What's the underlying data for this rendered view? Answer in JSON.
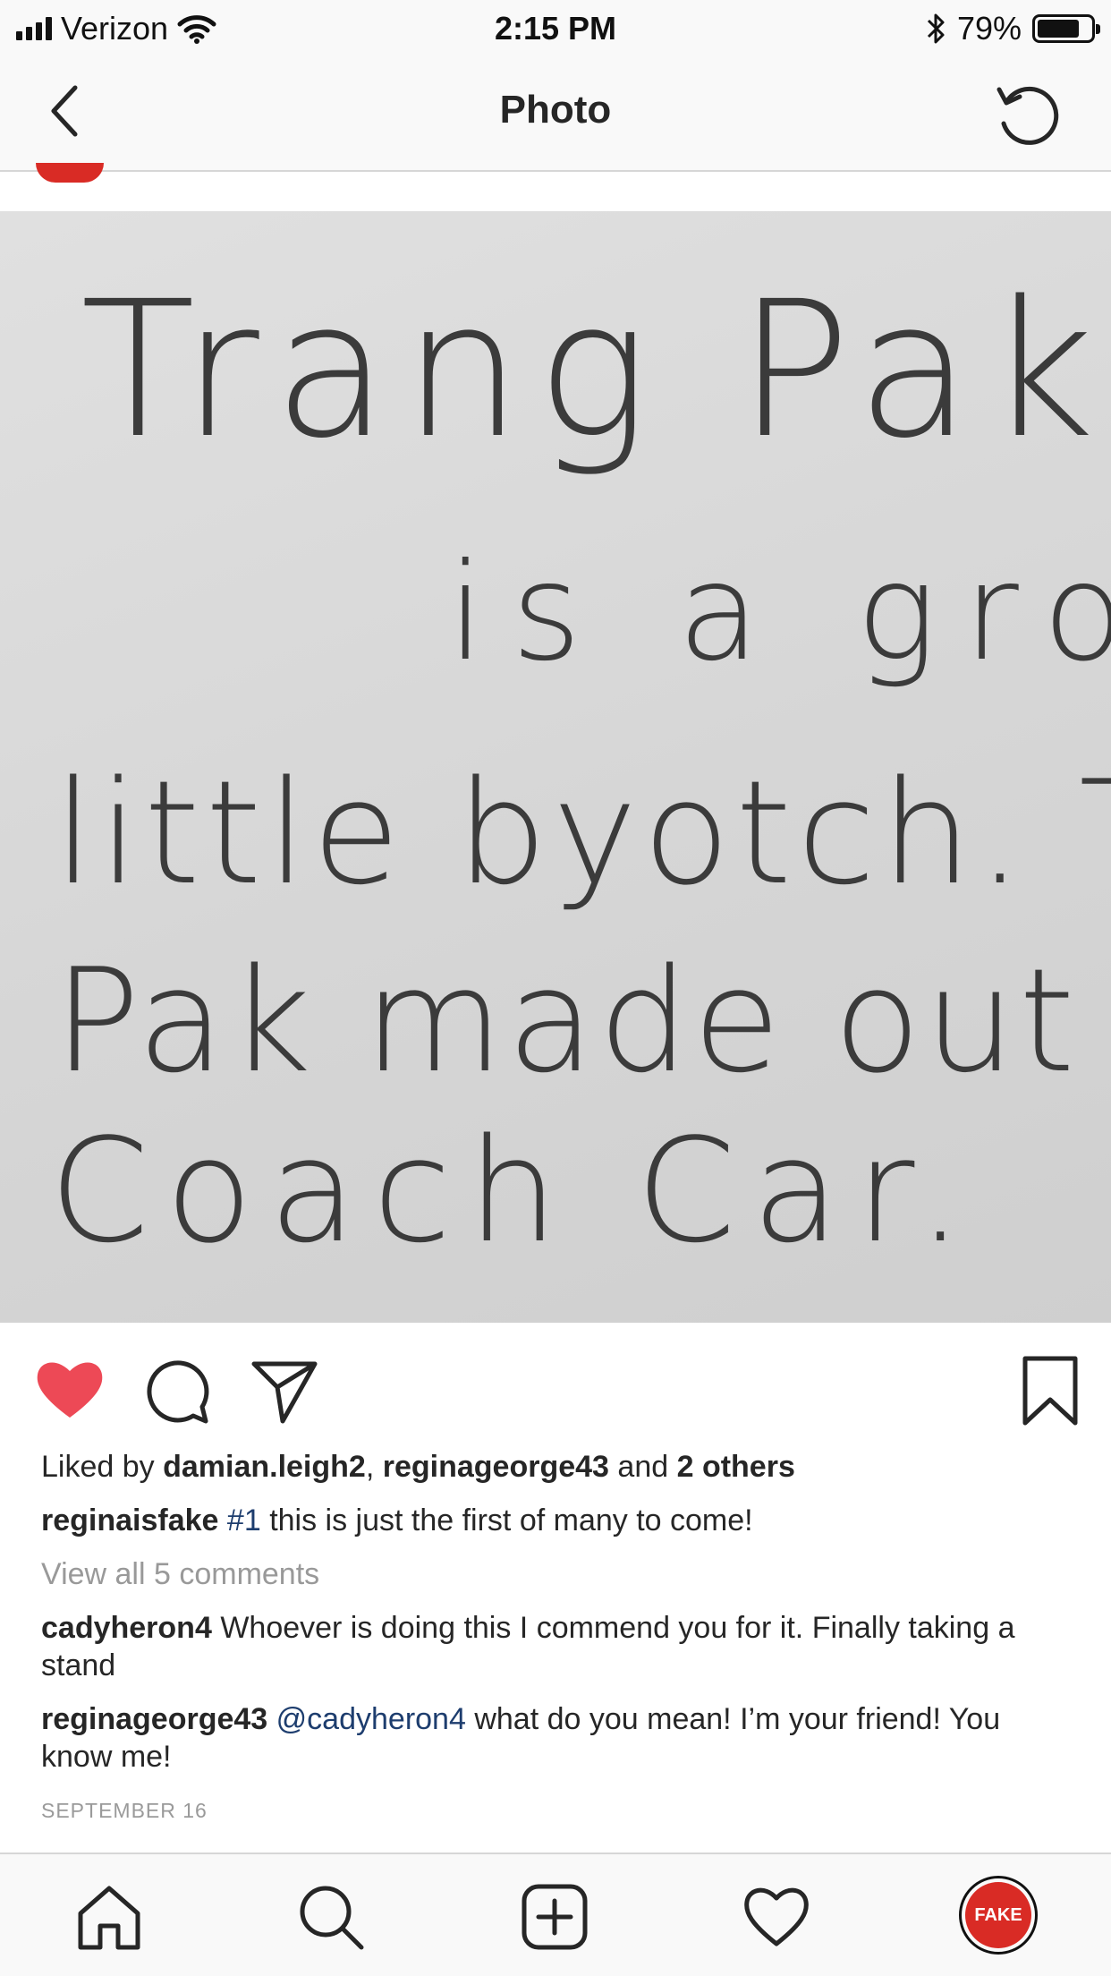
{
  "status_bar": {
    "carrier": "Verizon",
    "time": "2:15 PM",
    "battery_percent": "79%",
    "battery_level": 0.79
  },
  "nav": {
    "title": "Photo",
    "back_icon": "chevron-left-icon",
    "refresh_icon": "refresh-icon"
  },
  "photo": {
    "handwritten_lines": [
      "Trang Pak:",
      "is a grotsky",
      "little byotch. Trang",
      "Pak made out with",
      "Coach Car."
    ]
  },
  "post": {
    "liked": true,
    "like_color": "#ed4956",
    "likes": {
      "prefix": "Liked by",
      "user1": "damian.leigh2",
      "separator": ",",
      "user2": "reginageorge43",
      "conjunction": "and",
      "others": "2 others"
    },
    "caption": {
      "username": "reginaisfake",
      "hashtag": "#1",
      "text": "this is just the first of many to come!"
    },
    "view_all_comments": "View all 5 comments",
    "comments": [
      {
        "username": "cadyheron4",
        "mention": "",
        "text": "Whoever is doing this I commend you for it. Finally taking a stand"
      },
      {
        "username": "reginageorge43",
        "mention": "@cadyheron4",
        "text": "what do you mean! I’m your friend! You know me!"
      }
    ],
    "date": "SEPTEMBER 16"
  },
  "tab_bar": {
    "items": [
      "home-icon",
      "search-icon",
      "add-post-icon",
      "activity-heart-icon",
      "profile-avatar"
    ],
    "profile_label": "FAKE",
    "profile_color": "#d92b25"
  }
}
